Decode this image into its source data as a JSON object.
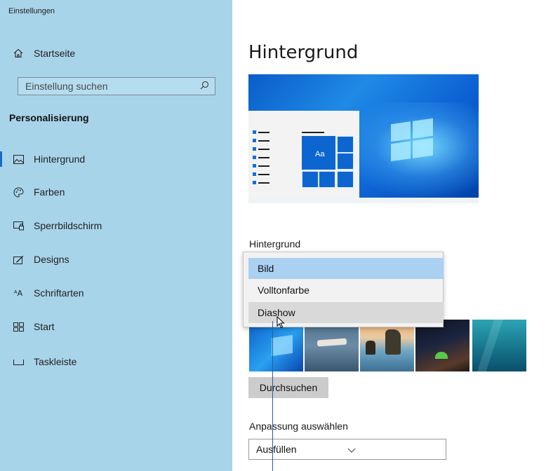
{
  "window": {
    "title": "Einstellungen"
  },
  "sidebar": {
    "home_label": "Startseite",
    "search_placeholder": "Einstellung suchen",
    "section_title": "Personalisierung",
    "items": [
      {
        "label": "Hintergrund",
        "icon": "picture-icon",
        "active": true
      },
      {
        "label": "Farben",
        "icon": "palette-icon",
        "active": false
      },
      {
        "label": "Sperrbildschirm",
        "icon": "lockscreen-icon",
        "active": false
      },
      {
        "label": "Designs",
        "icon": "designs-icon",
        "active": false
      },
      {
        "label": "Schriftarten",
        "icon": "fonts-icon",
        "active": false
      },
      {
        "label": "Start",
        "icon": "start-icon",
        "active": false
      },
      {
        "label": "Taskleiste",
        "icon": "taskbar-icon",
        "active": false
      }
    ]
  },
  "main": {
    "title": "Hintergrund",
    "preview": {
      "tile_text": "Aa"
    },
    "background_label": "Hintergrund",
    "background_dropdown": {
      "selected": "Bild",
      "options": [
        "Bild",
        "Volltonfarbe",
        "Diashow"
      ],
      "hovered": "Diashow"
    },
    "browse_button": "Durchsuchen",
    "fit_label": "Anpassung auswählen",
    "fit_value": "Ausfüllen"
  },
  "colors": {
    "sidebar_bg": "#a8d4ea",
    "accent": "#1b6ac9",
    "dropdown_selected": "#aad0f2",
    "dropdown_hover": "#d9d9d9",
    "callout_line": "#2b5d9c"
  }
}
